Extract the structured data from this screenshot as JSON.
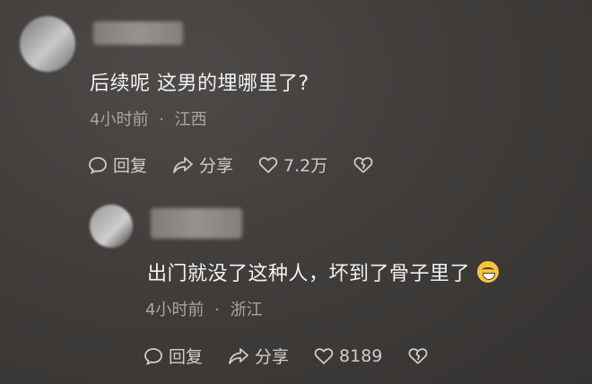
{
  "comments": [
    {
      "text": "后续呢 这男的埋哪里了?",
      "time": "4小时前",
      "location": "江西",
      "reply_label": "回复",
      "share_label": "分享",
      "like_count": "7.2万"
    },
    {
      "text": "出门就没了这种人，坏到了骨子里了",
      "time": "4小时前",
      "location": "浙江",
      "reply_label": "回复",
      "share_label": "分享",
      "like_count": "8189"
    }
  ],
  "separator": "·",
  "colors": {
    "text": "#f2f2f2",
    "meta": "#a8a5a3",
    "actions": "#d0cdcb"
  }
}
